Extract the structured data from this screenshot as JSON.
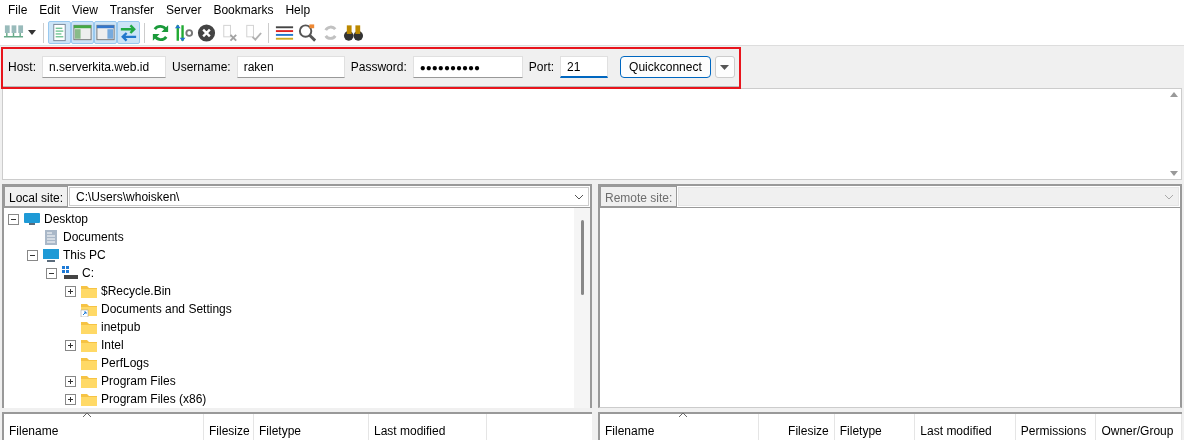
{
  "menu": [
    "File",
    "Edit",
    "View",
    "Transfer",
    "Server",
    "Bookmarks",
    "Help"
  ],
  "toolbar": [
    [
      {
        "kind": "sitemanager",
        "pressed": false,
        "disabled": false
      }
    ],
    [
      {
        "kind": "messagelog",
        "pressed": true,
        "disabled": false
      },
      {
        "kind": "localtree",
        "pressed": true,
        "disabled": false
      },
      {
        "kind": "remotetree",
        "pressed": true,
        "disabled": false
      },
      {
        "kind": "queue",
        "pressed": true,
        "disabled": false
      }
    ],
    [
      {
        "kind": "refresh",
        "pressed": false,
        "disabled": false
      },
      {
        "kind": "process",
        "pressed": false,
        "disabled": false
      },
      {
        "kind": "cancel",
        "pressed": false,
        "disabled": false
      },
      {
        "kind": "disconnect",
        "pressed": false,
        "disabled": true
      },
      {
        "kind": "reconnect",
        "pressed": false,
        "disabled": true
      }
    ],
    [
      {
        "kind": "filter",
        "pressed": false,
        "disabled": false
      },
      {
        "kind": "compare",
        "pressed": false,
        "disabled": false
      },
      {
        "kind": "sync",
        "pressed": false,
        "disabled": true
      },
      {
        "kind": "find",
        "pressed": false,
        "disabled": false
      }
    ]
  ],
  "quickconnect": {
    "highlighted": true,
    "fields": [
      {
        "label": "Host:",
        "value": "n.serverkita.web.id",
        "kind": "text",
        "focused": false
      },
      {
        "label": "Username:",
        "value": "raken",
        "kind": "text",
        "focused": false
      },
      {
        "label": "Password:",
        "value": "●●●●●●●●●●",
        "kind": "password",
        "focused": false
      },
      {
        "label": "Port:",
        "value": "21",
        "kind": "text",
        "focused": true
      }
    ],
    "button": "Quickconnect"
  },
  "local": {
    "label": "Local site:",
    "path": "C:\\Users\\whoisken\\",
    "tree": [
      {
        "name": "Desktop",
        "kind": "desktop",
        "expanded": true,
        "children": [
          {
            "name": "Documents",
            "kind": "documents"
          },
          {
            "name": "This PC",
            "kind": "pc",
            "expanded": true,
            "children": [
              {
                "name": "C:",
                "kind": "drive",
                "expanded": true,
                "children": [
                  {
                    "name": "$Recycle.Bin",
                    "kind": "folder",
                    "expanded": false
                  },
                  {
                    "name": "Documents and Settings",
                    "kind": "shortcut"
                  },
                  {
                    "name": "inetpub",
                    "kind": "folder"
                  },
                  {
                    "name": "Intel",
                    "kind": "folder",
                    "expanded": false
                  },
                  {
                    "name": "PerfLogs",
                    "kind": "folder"
                  },
                  {
                    "name": "Program Files",
                    "kind": "folder",
                    "expanded": false
                  },
                  {
                    "name": "Program Files (x86)",
                    "kind": "folder",
                    "expanded": false
                  }
                ]
              }
            ]
          }
        ]
      }
    ],
    "columns": [
      {
        "label": "Filename",
        "sorted": true
      },
      {
        "label": "Filesize",
        "sorted": false
      },
      {
        "label": "Filetype",
        "sorted": false
      },
      {
        "label": "Last modified",
        "sorted": false
      }
    ]
  },
  "remote": {
    "label": "Remote site:",
    "disabled": true,
    "columns": [
      {
        "label": "Filename",
        "sorted": true
      },
      {
        "label": "Filesize",
        "sorted": false
      },
      {
        "label": "Filetype",
        "sorted": false
      },
      {
        "label": "Last modified",
        "sorted": false
      },
      {
        "label": "Permissions",
        "sorted": false
      },
      {
        "label": "Owner/Group",
        "sorted": false
      }
    ]
  }
}
